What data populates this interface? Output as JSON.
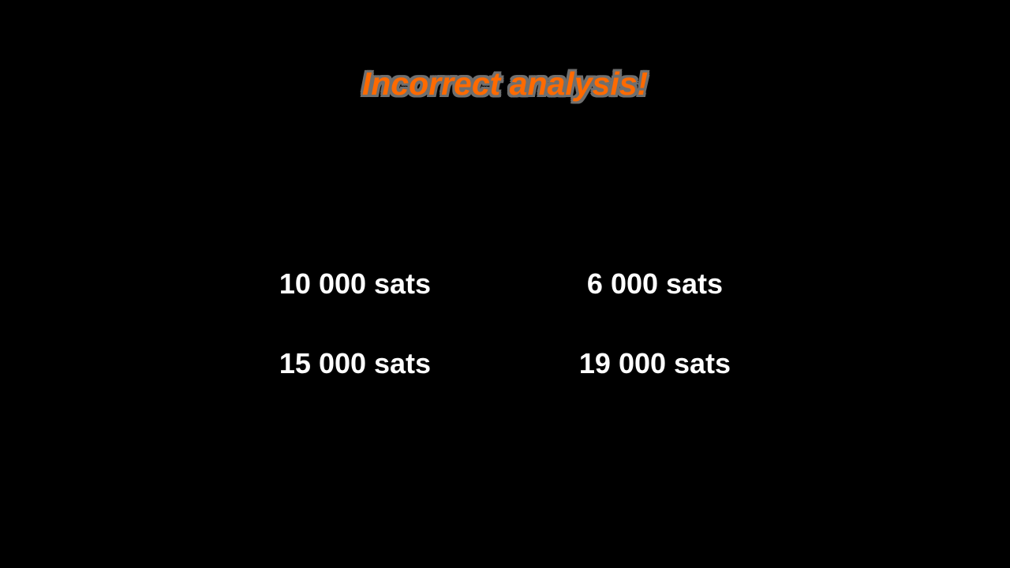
{
  "title": "Incorrect analysis!",
  "colors": {
    "background": "#000000",
    "title": "#FF6A00",
    "title_outline": "#6f6f6f",
    "option_text": "#ffffff"
  },
  "options": [
    {
      "label": "10 000 sats"
    },
    {
      "label": "6 000 sats"
    },
    {
      "label": "15 000 sats"
    },
    {
      "label": "19 000 sats"
    }
  ]
}
